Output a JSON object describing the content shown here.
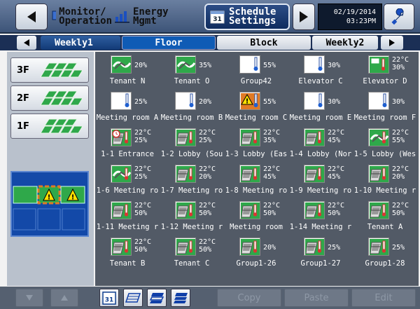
{
  "header": {
    "monitor_label": "Monitor/\nOperation",
    "energy_label": "Energy\nMgmt",
    "schedule_label": "Schedule\nSettings",
    "date": "02/19/2014",
    "time": "03:23PM"
  },
  "tabs": {
    "weekly1": "Weekly1",
    "floor": "Floor",
    "block": "Block",
    "weekly2": "Weekly2"
  },
  "floors": [
    "3F",
    "2F",
    "1F"
  ],
  "groups": [
    {
      "name": "Tenant N",
      "value": "20%",
      "icon": "ventilator"
    },
    {
      "name": "Tenant O",
      "value": "35%",
      "icon": "ventilator"
    },
    {
      "name": "Group42",
      "value": "55%",
      "icon": "thermometer"
    },
    {
      "name": "Elevator C",
      "value": "30%",
      "icon": "thermometer"
    },
    {
      "name": "Elevator D",
      "value": "22°C\n30%",
      "icon": "aircon-green"
    },
    {
      "name": "Meeting room A",
      "value": "25%",
      "icon": "thermometer"
    },
    {
      "name": "Meeting room B",
      "value": "20%",
      "icon": "thermometer"
    },
    {
      "name": "Meeting room C",
      "value": "55%",
      "icon": "warning-orange"
    },
    {
      "name": "Meeting room E",
      "value": "30%",
      "icon": "thermometer"
    },
    {
      "name": "Meeting room F",
      "value": "30%",
      "icon": "thermometer"
    },
    {
      "name": "1-1 Entrance",
      "value": "22°C\n25%",
      "icon": "aircon-timer"
    },
    {
      "name": "1-2 Lobby (Sou",
      "value": "22°C\n25%",
      "icon": "aircon"
    },
    {
      "name": "1-3 Lobby (Eas",
      "value": "22°C\n35%",
      "icon": "aircon"
    },
    {
      "name": "1-4 Lobby (Nor",
      "value": "22°C\n45%",
      "icon": "aircon"
    },
    {
      "name": "1-5 Lobby (Wes",
      "value": "22°C\n55%",
      "icon": "ventilator-aircon"
    },
    {
      "name": "1-6 Meeting ro",
      "value": "22°C\n25%",
      "icon": "ventilator-aircon"
    },
    {
      "name": "1-7 Meeting ro",
      "value": "22°C\n20%",
      "icon": "aircon"
    },
    {
      "name": "1-8 Meeting ro",
      "value": "22°C\n45%",
      "icon": "aircon"
    },
    {
      "name": "1-9 Meeting ro",
      "value": "22°C\n45%",
      "icon": "aircon"
    },
    {
      "name": "1-10 Meeting r",
      "value": "22°C\n20%",
      "icon": "aircon"
    },
    {
      "name": "1-11 Meeting r",
      "value": "22°C\n50%",
      "icon": "aircon"
    },
    {
      "name": "1-12 Meeting r",
      "value": "22°C\n50%",
      "icon": "aircon"
    },
    {
      "name": "Meeting room",
      "value": "22°C\n50%",
      "icon": "aircon"
    },
    {
      "name": "1-14 Meeting r",
      "value": "22°C\n50%",
      "icon": "aircon"
    },
    {
      "name": "Tenant A",
      "value": "22°C\n50%",
      "icon": "aircon"
    },
    {
      "name": "Tenant B",
      "value": "22°C\n50%",
      "icon": "aircon"
    },
    {
      "name": "Tenant C",
      "value": "22°C\n50%",
      "icon": "aircon"
    },
    {
      "name": "Group1-26",
      "value": "20%",
      "icon": "aircon"
    },
    {
      "name": "Group1-27",
      "value": "25%",
      "icon": "aircon"
    },
    {
      "name": "Group1-28",
      "value": "25%",
      "icon": "aircon"
    }
  ],
  "bottom": {
    "calendar_day": "31",
    "copy_label": "Copy",
    "paste_label": "Paste",
    "edit_label": "Edit"
  },
  "colors": {
    "group_green": "#3fae5a",
    "warning_yellow": "#ffe000",
    "warning_orange": "#e07a25",
    "selection_blue": "#1349a8"
  }
}
